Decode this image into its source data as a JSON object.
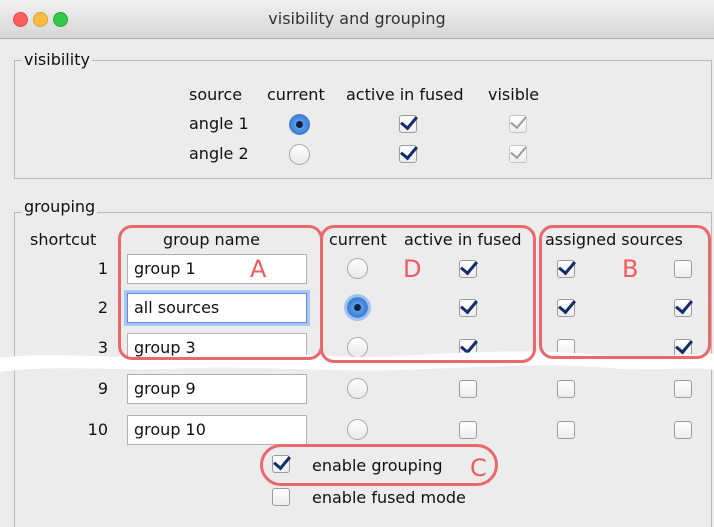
{
  "window": {
    "title": "visibility and grouping"
  },
  "visibility": {
    "legend": "visibility",
    "headers": {
      "source": "source",
      "current": "current",
      "active": "active in fused",
      "visible": "visible"
    },
    "rows": [
      {
        "name": "angle 1",
        "current": true,
        "active": true,
        "visible": true
      },
      {
        "name": "angle 2",
        "current": false,
        "active": true,
        "visible": true
      }
    ]
  },
  "grouping": {
    "legend": "grouping",
    "headers": {
      "shortcut": "shortcut",
      "name": "group name",
      "current": "current",
      "active": "active in fused",
      "assigned": "assigned sources"
    },
    "rows": [
      {
        "shortcut": "1",
        "name": "group 1",
        "current": false,
        "active": true,
        "assigned": [
          true,
          false
        ]
      },
      {
        "shortcut": "2",
        "name": "all sources",
        "current": true,
        "active": true,
        "assigned": [
          true,
          true
        ]
      },
      {
        "shortcut": "3",
        "name": "group 3",
        "current": false,
        "active": true,
        "assigned": [
          false,
          true
        ]
      },
      {
        "shortcut": "9",
        "name": "group 9",
        "current": false,
        "active": false,
        "assigned": [
          false,
          false
        ]
      },
      {
        "shortcut": "10",
        "name": "group 10",
        "current": false,
        "active": false,
        "assigned": [
          false,
          false
        ]
      }
    ],
    "enable_grouping": {
      "label": "enable grouping",
      "checked": true
    },
    "enable_fused": {
      "label": "enable fused mode",
      "checked": false
    }
  },
  "annotations": {
    "a": "A",
    "b": "B",
    "c": "C",
    "d": "D",
    "color": "#e9686b"
  }
}
